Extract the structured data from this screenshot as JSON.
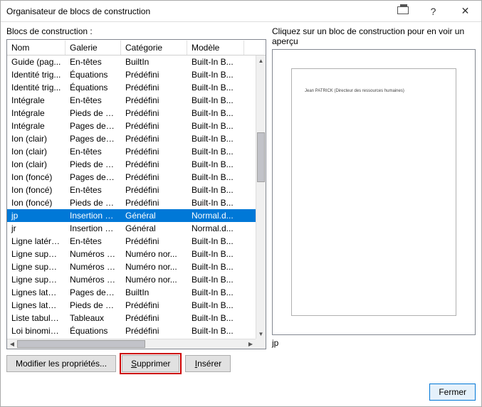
{
  "window": {
    "title": "Organisateur de blocs de construction"
  },
  "left": {
    "label": "Blocs de construction :",
    "columns": {
      "nom": "Nom",
      "galerie": "Galerie",
      "categorie": "Catégorie",
      "modele": "Modèle"
    }
  },
  "right": {
    "label": "Cliquez sur un bloc de construction pour en voir un aperçu",
    "preview_text": "Jean PATRICK (Directeur des ressources humaines)",
    "preview_name": "jp"
  },
  "rows": [
    {
      "nom": "Guide (pag...",
      "gal": "En-têtes",
      "cat": "BuiltIn",
      "mod": "Built-In B..."
    },
    {
      "nom": "Identité trig...",
      "gal": "Équations",
      "cat": "Prédéfini",
      "mod": "Built-In B..."
    },
    {
      "nom": "Identité trig...",
      "gal": "Équations",
      "cat": "Prédéfini",
      "mod": "Built-In B..."
    },
    {
      "nom": "Intégrale",
      "gal": "En-têtes",
      "cat": "Prédéfini",
      "mod": "Built-In B..."
    },
    {
      "nom": "Intégrale",
      "gal": "Pieds de p...",
      "cat": "Prédéfini",
      "mod": "Built-In B..."
    },
    {
      "nom": "Intégrale",
      "gal": "Pages de g...",
      "cat": "Prédéfini",
      "mod": "Built-In B..."
    },
    {
      "nom": "Ion (clair)",
      "gal": "Pages de g...",
      "cat": "Prédéfini",
      "mod": "Built-In B..."
    },
    {
      "nom": "Ion (clair)",
      "gal": "En-têtes",
      "cat": "Prédéfini",
      "mod": "Built-In B..."
    },
    {
      "nom": "Ion (clair)",
      "gal": "Pieds de p...",
      "cat": "Prédéfini",
      "mod": "Built-In B..."
    },
    {
      "nom": "Ion (foncé)",
      "gal": "Pages de g...",
      "cat": "Prédéfini",
      "mod": "Built-In B..."
    },
    {
      "nom": "Ion (foncé)",
      "gal": "En-têtes",
      "cat": "Prédéfini",
      "mod": "Built-In B..."
    },
    {
      "nom": "Ion (foncé)",
      "gal": "Pieds de p...",
      "cat": "Prédéfini",
      "mod": "Built-In B..."
    },
    {
      "nom": "jp",
      "gal": "Insertion a...",
      "cat": "Général",
      "mod": "Normal.d...",
      "selected": true
    },
    {
      "nom": "jr",
      "gal": "Insertion a...",
      "cat": "Général",
      "mod": "Normal.d..."
    },
    {
      "nom": "Ligne latérale",
      "gal": "En-têtes",
      "cat": "Prédéfini",
      "mod": "Built-In B..."
    },
    {
      "nom": "Ligne supér...",
      "gal": "Numéros d...",
      "cat": "Numéro nor...",
      "mod": "Built-In B..."
    },
    {
      "nom": "Ligne supér...",
      "gal": "Numéros d...",
      "cat": "Numéro nor...",
      "mod": "Built-In B..."
    },
    {
      "nom": "Ligne supér...",
      "gal": "Numéros d...",
      "cat": "Numéro nor...",
      "mod": "Built-In B..."
    },
    {
      "nom": "Lignes latér...",
      "gal": "Pages de g...",
      "cat": "BuiltIn",
      "mod": "Built-In B..."
    },
    {
      "nom": "Lignes latér...",
      "gal": "Pieds de p...",
      "cat": "Prédéfini",
      "mod": "Built-In B..."
    },
    {
      "nom": "Liste tabulai...",
      "gal": "Tableaux",
      "cat": "Prédéfini",
      "mod": "Built-In B..."
    },
    {
      "nom": "Loi binomiale",
      "gal": "Équations",
      "cat": "Prédéfini",
      "mod": "Built-In B..."
    }
  ],
  "buttons": {
    "modify": "Modifier les propriétés...",
    "delete": "Supprimer",
    "insert": "Insérer",
    "close": "Fermer"
  }
}
